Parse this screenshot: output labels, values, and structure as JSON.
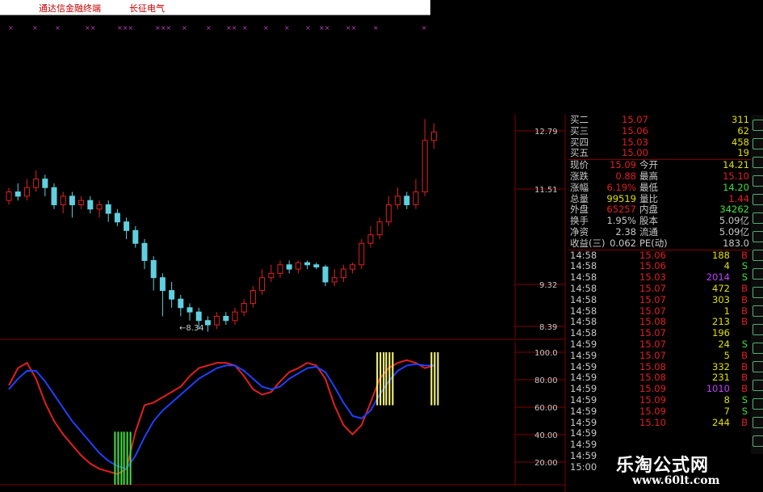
{
  "topbar": {
    "app_title": "通达信金融终端",
    "stock_name": "长征电气"
  },
  "price_axis": {
    "labels": [
      "12.79",
      "11.51",
      "9.32",
      "8.39"
    ],
    "low_marker": "←8.34"
  },
  "indicator_axis": {
    "labels": [
      "100.0",
      "80.00",
      "60.00",
      "40.00",
      "20.00"
    ]
  },
  "quote_panel": {
    "bids": [
      {
        "label": "买二",
        "price": "15.07",
        "vol": "311"
      },
      {
        "label": "买三",
        "price": "15.06",
        "vol": "62"
      },
      {
        "label": "买四",
        "price": "15.03",
        "vol": "458"
      },
      {
        "label": "买五",
        "price": "15.00",
        "vol": "19"
      }
    ],
    "stats": [
      {
        "l1": "现价",
        "v1": "15.09",
        "l2": "今开",
        "v2": "14.21"
      },
      {
        "l1": "涨跌",
        "v1": "0.88",
        "l2": "最高",
        "v2": "15.10"
      },
      {
        "l1": "涨幅",
        "v1": "6.19%",
        "l2": "最低",
        "v2": "14.20"
      },
      {
        "l1": "总量",
        "v1": "99519",
        "l2": "量比",
        "v2": "1.44"
      },
      {
        "l1": "外盘",
        "v1": "65257",
        "l2": "内盘",
        "v2": "34262"
      },
      {
        "l1": "换手",
        "v1": "1.95%",
        "l2": "股本",
        "v2": "5.09亿"
      },
      {
        "l1": "净资",
        "v1": "2.38",
        "l2": "流通",
        "v2": "5.09亿"
      },
      {
        "l1": "收益(三)",
        "v1": "0.062",
        "l2": "PE(动)",
        "v2": "183.0"
      }
    ]
  },
  "ticks": [
    {
      "time": "14:58",
      "price": "15.06",
      "vol": "188",
      "side": "B"
    },
    {
      "time": "14:58",
      "price": "15.06",
      "vol": "4",
      "side": "S"
    },
    {
      "time": "14:58",
      "price": "15.03",
      "vol": "2014",
      "side": "S"
    },
    {
      "time": "14:58",
      "price": "15.07",
      "vol": "472",
      "side": "B"
    },
    {
      "time": "14:58",
      "price": "15.07",
      "vol": "303",
      "side": "B"
    },
    {
      "time": "14:58",
      "price": "15.07",
      "vol": "1",
      "side": "B"
    },
    {
      "time": "14:58",
      "price": "15.08",
      "vol": "213",
      "side": "B"
    },
    {
      "time": "14:58",
      "price": "15.07",
      "vol": "196",
      "side": ""
    },
    {
      "time": "14:59",
      "price": "15.07",
      "vol": "24",
      "side": "S"
    },
    {
      "time": "14:59",
      "price": "15.07",
      "vol": "5",
      "side": "B"
    },
    {
      "time": "14:59",
      "price": "15.08",
      "vol": "332",
      "side": "B"
    },
    {
      "time": "14:59",
      "price": "15.08",
      "vol": "231",
      "side": "B"
    },
    {
      "time": "14:59",
      "price": "15.09",
      "vol": "1010",
      "side": "B"
    },
    {
      "time": "14:59",
      "price": "15.09",
      "vol": "8",
      "side": "S"
    },
    {
      "time": "14:59",
      "price": "15.09",
      "vol": "7",
      "side": "S"
    },
    {
      "time": "14:59",
      "price": "15.10",
      "vol": "244",
      "side": "B"
    },
    {
      "time": "14:59",
      "price": "",
      "vol": "",
      "side": ""
    },
    {
      "time": "14:59",
      "price": "",
      "vol": "",
      "side": ""
    },
    {
      "time": "14:59",
      "price": "",
      "vol": "",
      "side": ""
    },
    {
      "time": "15:00",
      "price": "",
      "vol": "",
      "side": ""
    }
  ],
  "watermark": {
    "cn": "乐淘公式网",
    "url": "www.60lt.com"
  },
  "colors": {
    "up": "#e02020",
    "down": "#60d0e0",
    "k_line": "#e02020",
    "d_line": "#2040ff",
    "signal_buy": "#40e040",
    "signal_sell": "#ffff80",
    "grid": "#800000"
  },
  "chart_data": {
    "type": "candlestick",
    "price_range": [
      8.2,
      13.4
    ],
    "indicator_range": [
      0,
      100
    ],
    "candles": [
      {
        "o": 11.4,
        "c": 11.6,
        "h": 11.7,
        "l": 11.3
      },
      {
        "o": 11.6,
        "c": 11.5,
        "h": 11.8,
        "l": 11.4
      },
      {
        "o": 11.5,
        "c": 11.7,
        "h": 11.9,
        "l": 11.4
      },
      {
        "o": 11.7,
        "c": 11.9,
        "h": 12.1,
        "l": 11.6
      },
      {
        "o": 11.9,
        "c": 11.7,
        "h": 12.0,
        "l": 11.5
      },
      {
        "o": 11.7,
        "c": 11.3,
        "h": 11.8,
        "l": 11.2
      },
      {
        "o": 11.3,
        "c": 11.5,
        "h": 11.6,
        "l": 11.1
      },
      {
        "o": 11.5,
        "c": 11.3,
        "h": 11.6,
        "l": 11.0
      },
      {
        "o": 11.3,
        "c": 11.4,
        "h": 11.5,
        "l": 11.2
      },
      {
        "o": 11.4,
        "c": 11.2,
        "h": 11.5,
        "l": 11.1
      },
      {
        "o": 11.2,
        "c": 11.3,
        "h": 11.4,
        "l": 11.0
      },
      {
        "o": 11.3,
        "c": 11.1,
        "h": 11.4,
        "l": 10.9
      },
      {
        "o": 11.1,
        "c": 10.9,
        "h": 11.2,
        "l": 10.8
      },
      {
        "o": 10.9,
        "c": 10.7,
        "h": 11.0,
        "l": 10.5
      },
      {
        "o": 10.7,
        "c": 10.4,
        "h": 10.8,
        "l": 10.3
      },
      {
        "o": 10.4,
        "c": 10.0,
        "h": 10.5,
        "l": 9.8
      },
      {
        "o": 10.0,
        "c": 9.6,
        "h": 10.1,
        "l": 9.3
      },
      {
        "o": 9.6,
        "c": 9.3,
        "h": 9.7,
        "l": 8.7
      },
      {
        "o": 9.3,
        "c": 9.1,
        "h": 9.5,
        "l": 8.9
      },
      {
        "o": 9.1,
        "c": 8.9,
        "h": 9.2,
        "l": 8.7
      },
      {
        "o": 8.9,
        "c": 8.8,
        "h": 9.0,
        "l": 8.6
      },
      {
        "o": 8.8,
        "c": 8.6,
        "h": 8.9,
        "l": 8.4
      },
      {
        "o": 8.6,
        "c": 8.5,
        "h": 8.7,
        "l": 8.34
      },
      {
        "o": 8.5,
        "c": 8.7,
        "h": 8.8,
        "l": 8.4
      },
      {
        "o": 8.7,
        "c": 8.6,
        "h": 8.8,
        "l": 8.5
      },
      {
        "o": 8.6,
        "c": 8.8,
        "h": 8.9,
        "l": 8.5
      },
      {
        "o": 8.8,
        "c": 9.0,
        "h": 9.1,
        "l": 8.7
      },
      {
        "o": 9.0,
        "c": 9.3,
        "h": 9.4,
        "l": 8.9
      },
      {
        "o": 9.3,
        "c": 9.6,
        "h": 9.8,
        "l": 9.2
      },
      {
        "o": 9.6,
        "c": 9.7,
        "h": 9.9,
        "l": 9.5
      },
      {
        "o": 9.7,
        "c": 9.9,
        "h": 10.0,
        "l": 9.6
      },
      {
        "o": 9.9,
        "c": 9.8,
        "h": 10.0,
        "l": 9.7
      },
      {
        "o": 9.8,
        "c": 9.95,
        "h": 10.0,
        "l": 9.7
      },
      {
        "o": 9.95,
        "c": 9.9,
        "h": 10.0,
        "l": 9.8
      },
      {
        "o": 9.9,
        "c": 9.85,
        "h": 9.95,
        "l": 9.8
      },
      {
        "o": 9.85,
        "c": 9.5,
        "h": 9.9,
        "l": 9.4
      },
      {
        "o": 9.5,
        "c": 9.6,
        "h": 9.8,
        "l": 9.4
      },
      {
        "o": 9.6,
        "c": 9.8,
        "h": 9.9,
        "l": 9.5
      },
      {
        "o": 9.8,
        "c": 9.9,
        "h": 9.95,
        "l": 9.7
      },
      {
        "o": 9.9,
        "c": 10.4,
        "h": 10.5,
        "l": 9.8
      },
      {
        "o": 10.4,
        "c": 10.6,
        "h": 10.8,
        "l": 10.3
      },
      {
        "o": 10.6,
        "c": 10.9,
        "h": 11.0,
        "l": 10.5
      },
      {
        "o": 10.9,
        "c": 11.3,
        "h": 11.5,
        "l": 10.8
      },
      {
        "o": 11.3,
        "c": 11.5,
        "h": 11.7,
        "l": 11.2
      },
      {
        "o": 11.5,
        "c": 11.3,
        "h": 11.6,
        "l": 11.2
      },
      {
        "o": 11.3,
        "c": 11.6,
        "h": 11.9,
        "l": 11.2
      },
      {
        "o": 11.6,
        "c": 12.8,
        "h": 13.3,
        "l": 11.5
      },
      {
        "o": 12.8,
        "c": 13.0,
        "h": 13.2,
        "l": 12.6
      }
    ],
    "kd_k": [
      75,
      88,
      92,
      80,
      62,
      48,
      38,
      30,
      22,
      16,
      12,
      10,
      8,
      12,
      40,
      60,
      62,
      66,
      70,
      74,
      82,
      88,
      90,
      92,
      92,
      90,
      82,
      72,
      68,
      70,
      78,
      85,
      88,
      92,
      90,
      80,
      60,
      45,
      38,
      45,
      62,
      80,
      88,
      92,
      94,
      92,
      88,
      90
    ],
    "kd_d": [
      72,
      80,
      86,
      86,
      78,
      68,
      58,
      48,
      40,
      32,
      24,
      18,
      14,
      12,
      22,
      36,
      48,
      56,
      62,
      68,
      74,
      80,
      84,
      88,
      90,
      90,
      86,
      80,
      74,
      72,
      74,
      80,
      84,
      88,
      89,
      85,
      74,
      62,
      52,
      50,
      56,
      68,
      78,
      86,
      90,
      91,
      90,
      90
    ],
    "buy_signals": [
      12,
      13
    ],
    "sell_signals": [
      41,
      42,
      47
    ]
  }
}
